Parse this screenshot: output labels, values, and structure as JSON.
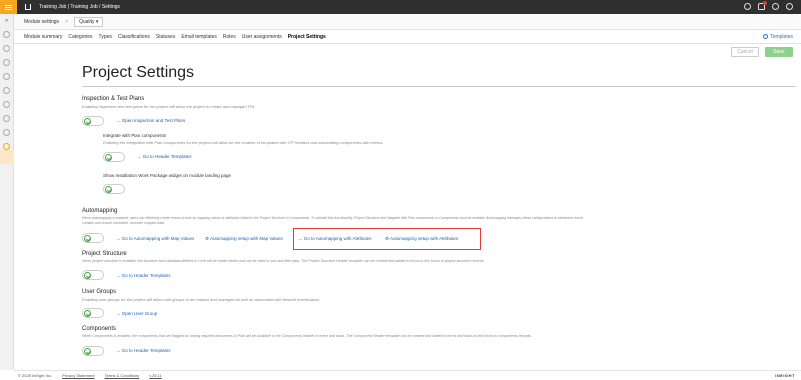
{
  "topbar": {
    "breadcrumb": "Training Job | Training Job  /  Settings"
  },
  "subheader": {
    "module_settings": "Module settings",
    "quality": "Quality"
  },
  "tabs": [
    "Module summary",
    "Categories",
    "Types",
    "Classifications",
    "Statuses",
    "Email templates",
    "Roles",
    "User assignments",
    "Project Settings"
  ],
  "templates_link": "Templates",
  "buttons": {
    "cancel": "Cancel",
    "save": "Save"
  },
  "page_title": "Project Settings",
  "itp": {
    "heading": "Inspection & Test Plans",
    "desc": "Enabling inspection and test plans for the project will allow the project to create and manage ITPs.",
    "link": "Open Inspection and Test Plans",
    "integrate_heading": "Integrate with Plan components",
    "integrate_desc": "Enabling the integration with Plan components for the project will allow for the creation of templates with ITP headers and associating components with events.",
    "integrate_link": "Go to Header Templates",
    "iwp_heading": "Show Installation Work Package widget on module landing page"
  },
  "automapping": {
    "heading": "Automapping",
    "desc1": "When automapping is enabled, users can efficiently create events in bulk by mapping values or attributes linked to the Project Structure or Components. To activate this functionality, Project Structure and Integrate with Plan components or Components must be enabled. Automapping leverages these configurations to streamline event",
    "desc2": "creation and ensure consistent, accurate mapped data.",
    "link1": "Go to Automapping with Map Values",
    "link2": "Automapping setup with Map Values",
    "link3": "Go to Automapping with Attributes",
    "link4": "Automapping setup with Attributes"
  },
  "project_structure": {
    "heading": "Project Structure",
    "desc": "When project structure is enabled, the structure and metadata defined in Core will be made visible and can be used to sort and filter data. The Project Structure Header template can be created and added to forms to link forms to project structure records.",
    "link": "Go to Header Templates"
  },
  "user_groups": {
    "heading": "User Groups",
    "desc": "Enabling user groups for the project will allow user groups to be created and managed as well as associated with desired events/tasks.",
    "link": "Open User Group"
  },
  "components": {
    "heading": "Components",
    "desc": "When Components is enabled, the components that are flagged as having required documents in Plan will be available in the Components header in event and tasks. The Component Header template can be created and added to forms and tasks to link forms to components records.",
    "link": "Go to Header Templates"
  },
  "footer": {
    "copyright": "© 2025 InEight Inc.",
    "privacy": "Privacy Statement",
    "terms": "Terms & Conditions",
    "version": "v.25.11",
    "brand": "INEIGHT"
  },
  "colors": {
    "accent": "#f5a623",
    "toggle_on": "#47a447",
    "link": "#1f5fb4",
    "highlight": "#e53935",
    "save": "#8ed18a"
  }
}
